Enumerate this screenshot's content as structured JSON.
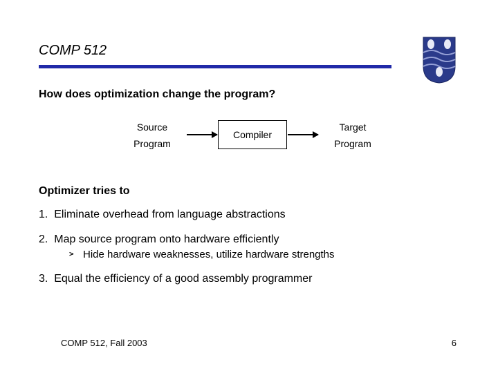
{
  "header": {
    "course": "COMP 512"
  },
  "subtitle": "How does optimization change the program?",
  "diagram": {
    "source_top": "Source",
    "source_bottom": "Program",
    "compiler": "Compiler",
    "target_top": "Target",
    "target_bottom": "Program"
  },
  "body": {
    "lead": "Optimizer tries to",
    "items": [
      {
        "n": "1.",
        "text": "Eliminate overhead from language abstractions"
      },
      {
        "n": "2.",
        "text": "Map source program onto hardware efficiently",
        "sub": "Hide hardware weaknesses, utilize hardware strengths"
      },
      {
        "n": "3.",
        "text": "Equal the efficiency of a good assembly programmer"
      }
    ]
  },
  "footer": {
    "left": "COMP 512, Fall 2003",
    "right": "6"
  }
}
